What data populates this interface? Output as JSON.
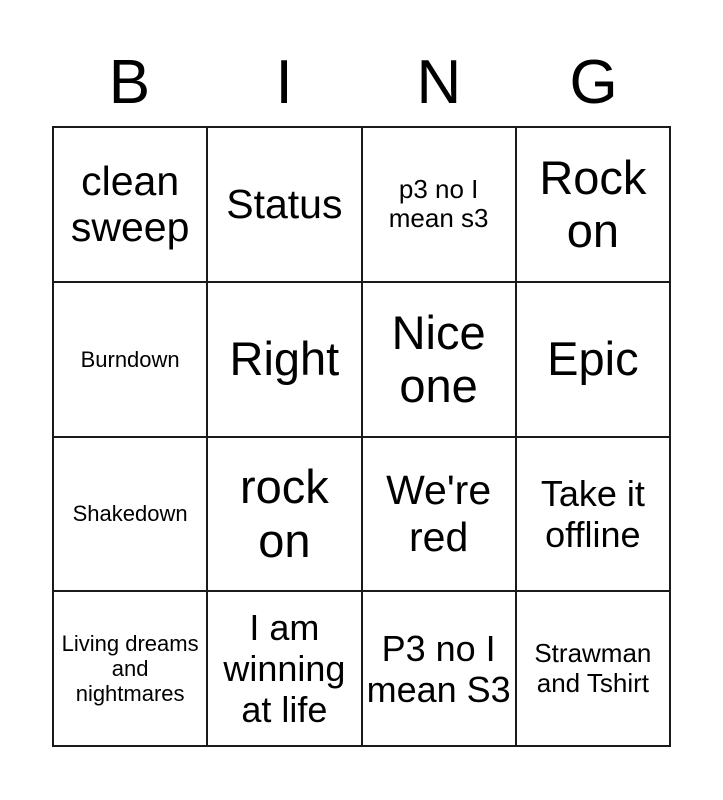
{
  "card": {
    "title_letters": [
      "B",
      "I",
      "N",
      "G"
    ],
    "colors": {
      "text": "#000000",
      "grid_line": "#1a1a1a",
      "background": "#ffffff"
    },
    "grid": {
      "columns": 4,
      "rows": 4,
      "cells": [
        {
          "text": "clean sweep",
          "size": "lg"
        },
        {
          "text": "Status",
          "size": "lg"
        },
        {
          "text": "p3 no I mean s3",
          "size": "sm"
        },
        {
          "text": "Rock on",
          "size": "xl"
        },
        {
          "text": "Burndown",
          "size": "xs"
        },
        {
          "text": "Right",
          "size": "xl"
        },
        {
          "text": "Nice one",
          "size": "xl"
        },
        {
          "text": "Epic",
          "size": "xl"
        },
        {
          "text": "Shakedown",
          "size": "xs"
        },
        {
          "text": "rock on",
          "size": "xl"
        },
        {
          "text": "We're red",
          "size": "lg"
        },
        {
          "text": "Take it offline",
          "size": "md"
        },
        {
          "text": "Living dreams and nightmares",
          "size": "xs"
        },
        {
          "text": "I am winning at life",
          "size": "md"
        },
        {
          "text": "P3 no I mean S3",
          "size": "md"
        },
        {
          "text": "Strawman and Tshirt",
          "size": "sm"
        }
      ]
    }
  }
}
